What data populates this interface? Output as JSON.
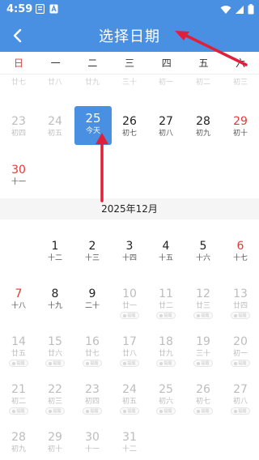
{
  "status_bar": {
    "time": "4:59"
  },
  "header": {
    "title": "选择日期"
  },
  "weekdays": [
    "日",
    "一",
    "二",
    "三",
    "四",
    "五",
    "六"
  ],
  "prev_row_cut": [
    "廿七",
    "廿八",
    "廿九",
    "三十",
    "初一",
    "初二",
    "初三"
  ],
  "november": {
    "week2": [
      {
        "day": "23",
        "lunar": "初四"
      },
      {
        "day": "24",
        "lunar": "初五"
      },
      {
        "day": "25",
        "lunar": "今天"
      },
      {
        "day": "26",
        "lunar": "初七"
      },
      {
        "day": "27",
        "lunar": "初八"
      },
      {
        "day": "28",
        "lunar": "初九"
      },
      {
        "day": "29",
        "lunar": "初十"
      }
    ],
    "week3": [
      {
        "day": "30",
        "lunar": "十一"
      }
    ]
  },
  "december": {
    "month_label": "2025年12月",
    "week1": [
      {
        "day": "1",
        "lunar": "十二"
      },
      {
        "day": "2",
        "lunar": "十三"
      },
      {
        "day": "3",
        "lunar": "十四"
      },
      {
        "day": "4",
        "lunar": "十五"
      },
      {
        "day": "5",
        "lunar": "十六"
      },
      {
        "day": "6",
        "lunar": "十七"
      }
    ],
    "week2": [
      {
        "day": "7",
        "lunar": "十八"
      },
      {
        "day": "8",
        "lunar": "十九"
      },
      {
        "day": "9",
        "lunar": "二十"
      },
      {
        "day": "10",
        "lunar": "廿一"
      },
      {
        "day": "11",
        "lunar": "廿二"
      },
      {
        "day": "12",
        "lunar": "廿三"
      },
      {
        "day": "13",
        "lunar": "廿四"
      }
    ],
    "week3": [
      {
        "day": "14",
        "lunar": "廿五"
      },
      {
        "day": "15",
        "lunar": "廿六"
      },
      {
        "day": "16",
        "lunar": "廿七"
      },
      {
        "day": "17",
        "lunar": "廿八"
      },
      {
        "day": "18",
        "lunar": "廿九"
      },
      {
        "day": "19",
        "lunar": "三十"
      },
      {
        "day": "20",
        "lunar": "初一"
      }
    ],
    "week4": [
      {
        "day": "21",
        "lunar": "初二"
      },
      {
        "day": "22",
        "lunar": "初三"
      },
      {
        "day": "23",
        "lunar": "初四"
      },
      {
        "day": "24",
        "lunar": "初五"
      },
      {
        "day": "25",
        "lunar": "初六"
      },
      {
        "day": "26",
        "lunar": "初七"
      },
      {
        "day": "27",
        "lunar": "初八"
      }
    ],
    "week5": [
      {
        "day": "28",
        "lunar": "初九"
      },
      {
        "day": "29",
        "lunar": "初十"
      },
      {
        "day": "30",
        "lunar": "十一"
      },
      {
        "day": "31",
        "lunar": "十二"
      }
    ]
  },
  "reminder_label": "提醒",
  "colors": {
    "accent": "#4a90e2",
    "weekend_red": "#e53935",
    "annotation_red": "#e0203a",
    "disabled_grey": "#bdbdbd"
  }
}
